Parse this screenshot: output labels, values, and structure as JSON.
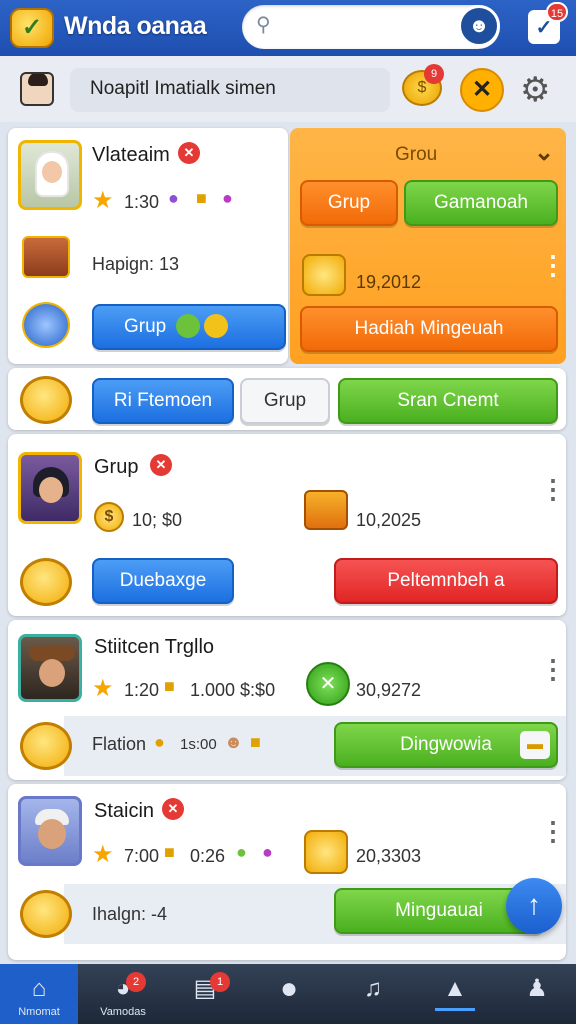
{
  "header": {
    "app_title": "Wnda oanaa",
    "logo_glyph": "✓",
    "search_placeholder": "",
    "notification_count": "15",
    "profile_icon": "profile-icon",
    "notify_icon": "check-box-icon"
  },
  "status_bar": {
    "status_text": "Noapitl Imatialk simen",
    "coins_badge": "9",
    "coins_glyph": "$",
    "close_label": "✕",
    "settings_icon": "gear-icon"
  },
  "card1": {
    "name": "Vlateaim",
    "stat": "1:30",
    "reward_label": "Hapign: 13",
    "group_button": "Grup",
    "coin_badge_text": "BLANK"
  },
  "orange_panel": {
    "title": "Grou",
    "grup_button": "Grup",
    "gamanoah_button": "Gamanoah",
    "amount": "19,2012",
    "weekly_button": "Hadiah Mingeuah"
  },
  "row2": {
    "ri_button": "Ri Ftemoen",
    "grup_button": "Grup",
    "sran_button": "Sran Cnemt"
  },
  "card3": {
    "name": "Grup",
    "stat": "10;  $0",
    "value": "10,2025",
    "coin_glyph": "$",
    "blue_button": "Duebaxge",
    "red_button": "Peltemnbeh a"
  },
  "card4": {
    "name": "Stiitcen Trgllo",
    "stat": "1:20",
    "extra": "1.000  $:$0",
    "value": "30,9272",
    "row_label": "Flation",
    "row_stat": "1s:00",
    "green_button": "Dingwowia"
  },
  "card5": {
    "name": "Staicin",
    "stat": "7:00",
    "extra": "0:26",
    "value": "20,3303",
    "row_label": "Ihalgn: -4",
    "green_button": "Minguauai"
  },
  "bottom_nav": {
    "items": [
      {
        "label": "Nmomat",
        "icon": "home-icon",
        "badge": ""
      },
      {
        "label": "Vamodas",
        "icon": "compass-icon",
        "badge": "2"
      },
      {
        "label": "",
        "icon": "chart-icon",
        "badge": "1"
      },
      {
        "label": "",
        "icon": "circle-icon",
        "badge": ""
      },
      {
        "label": "",
        "icon": "music-icon",
        "badge": ""
      },
      {
        "label": "",
        "icon": "trophy-icon",
        "badge": ""
      },
      {
        "label": "",
        "icon": "people-icon",
        "badge": ""
      }
    ]
  },
  "colors": {
    "topbar": "#2d63c6",
    "accent_orange": "#ffa020",
    "accent_green": "#4ab01f",
    "accent_blue": "#1c6fe0",
    "accent_red": "#e12525"
  }
}
